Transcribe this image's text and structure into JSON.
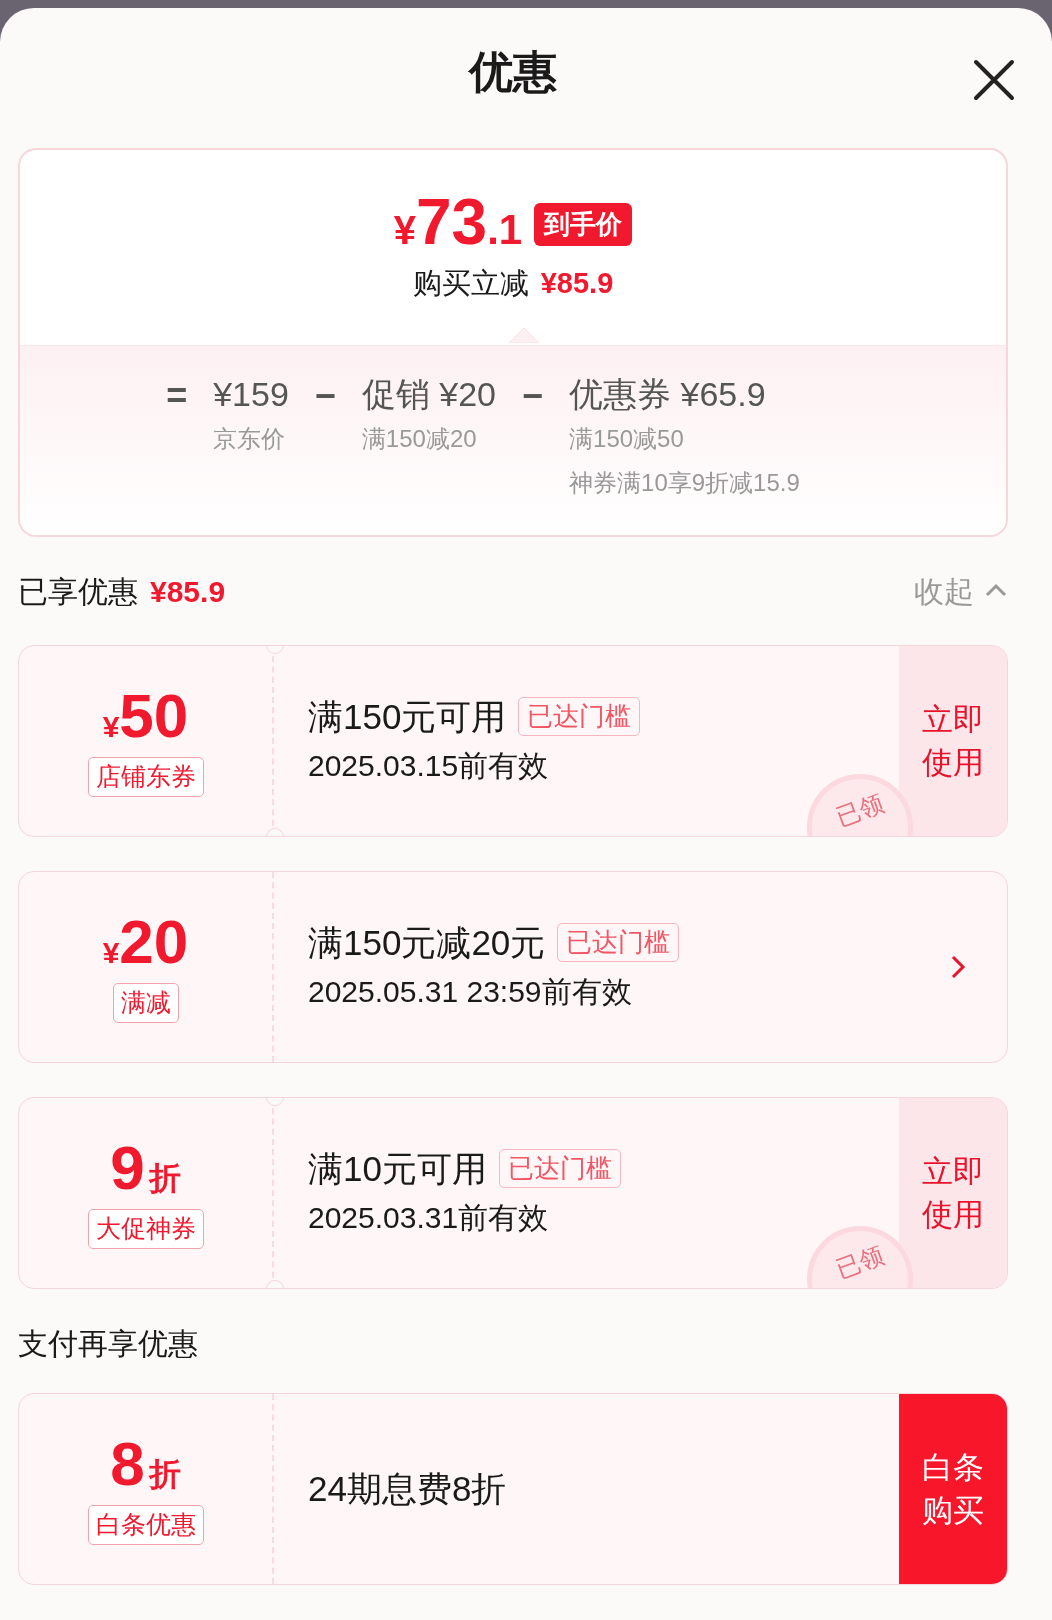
{
  "title": "优惠",
  "summary": {
    "price_currency": "¥",
    "price_int": "73",
    "price_dec": ".1",
    "price_badge": "到手价",
    "saving_label": "购买立减",
    "saving_amount": "¥85.9",
    "breakdown": [
      {
        "op": "=",
        "amount": "¥159",
        "notes": [
          "京东价"
        ]
      },
      {
        "op": "−",
        "amount": "促销 ¥20",
        "notes": [
          "满150减20"
        ]
      },
      {
        "op": "−",
        "amount": "优惠券 ¥65.9",
        "notes": [
          "满150减50",
          "神券满10享9折减15.9"
        ]
      }
    ]
  },
  "enjoyed": {
    "label": "已享优惠",
    "amount": "¥85.9",
    "toggle": "收起",
    "expanded": true
  },
  "coupons": [
    {
      "prefix": "¥",
      "value": "50",
      "tag": "店铺东券",
      "title": "满150元可用",
      "badge": "已达门槛",
      "validity": "2025.03.15前有效",
      "stamp": "已领",
      "action": {
        "kind": "button",
        "label": "立即使用"
      }
    },
    {
      "prefix": "¥",
      "value": "20",
      "tag": "满减",
      "title": "满150元减20元",
      "badge": "已达门槛",
      "validity": "2025.05.31 23:59前有效",
      "action": {
        "kind": "arrow"
      }
    },
    {
      "value": "9",
      "suffix": "折",
      "tag": "大促神券",
      "title": "满10元可用",
      "badge": "已达门槛",
      "validity": "2025.03.31前有效",
      "stamp": "已领",
      "action": {
        "kind": "button",
        "label": "立即使用"
      }
    }
  ],
  "payment": {
    "label": "支付再享优惠",
    "coupons": [
      {
        "value": "8",
        "suffix": "折",
        "tag": "白条优惠",
        "title": "24期息费8折",
        "action": {
          "kind": "primary",
          "label": "白条购买"
        }
      }
    ]
  }
}
